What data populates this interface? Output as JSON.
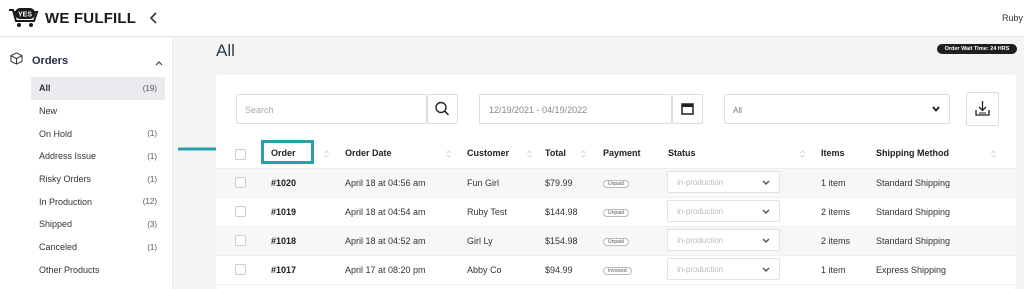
{
  "brand": {
    "logo_text": "WE FULFILL",
    "badge_text": "YES",
    "accent": "#2a9fa8"
  },
  "topbar": {
    "user_name": "Ruby"
  },
  "sidebar": {
    "section_label": "Orders",
    "items": [
      {
        "label": "All",
        "count": "(19)",
        "active": true
      },
      {
        "label": "New",
        "count": ""
      },
      {
        "label": "On Hold",
        "count": "(1)"
      },
      {
        "label": "Address Issue",
        "count": "(1)"
      },
      {
        "label": "Risky Orders",
        "count": "(1)"
      },
      {
        "label": "In Production",
        "count": "(12)"
      },
      {
        "label": "Shipped",
        "count": "(3)"
      },
      {
        "label": "Canceled",
        "count": "(1)"
      },
      {
        "label": "Other Products",
        "count": ""
      }
    ]
  },
  "page": {
    "title": "All",
    "wait_badge": "Order Wait Time: 24 HRS"
  },
  "filters": {
    "search_placeholder": "Search",
    "date_range": "12/19/2021 - 04/19/2022",
    "status_filter": "All"
  },
  "table": {
    "columns": [
      "Order",
      "Order Date",
      "Customer",
      "Total",
      "Payment",
      "Status",
      "Items",
      "Shipping Method"
    ],
    "rows": [
      {
        "order": "#1020",
        "date": "April 18 at 04:56 am",
        "customer": "Fun Girl",
        "total": "$79.99",
        "payment": "Unpaid",
        "status": "in-production",
        "items": "1 item",
        "shipping": "Standard Shipping"
      },
      {
        "order": "#1019",
        "date": "April 18 at 04:54 am",
        "customer": "Ruby Test",
        "total": "$144.98",
        "payment": "Unpaid",
        "status": "in-production",
        "items": "2 items",
        "shipping": "Standard Shipping"
      },
      {
        "order": "#1018",
        "date": "April 18 at 04:52 am",
        "customer": "Girl Ly",
        "total": "$154.98",
        "payment": "Unpaid",
        "status": "in-production",
        "items": "2 items",
        "shipping": "Standard Shipping"
      },
      {
        "order": "#1017",
        "date": "April 17 at 08:20 pm",
        "customer": "Abby Co",
        "total": "$94.99",
        "payment": "Invoiced",
        "status": "in-production",
        "items": "1 item",
        "shipping": "Express Shipping"
      }
    ]
  }
}
